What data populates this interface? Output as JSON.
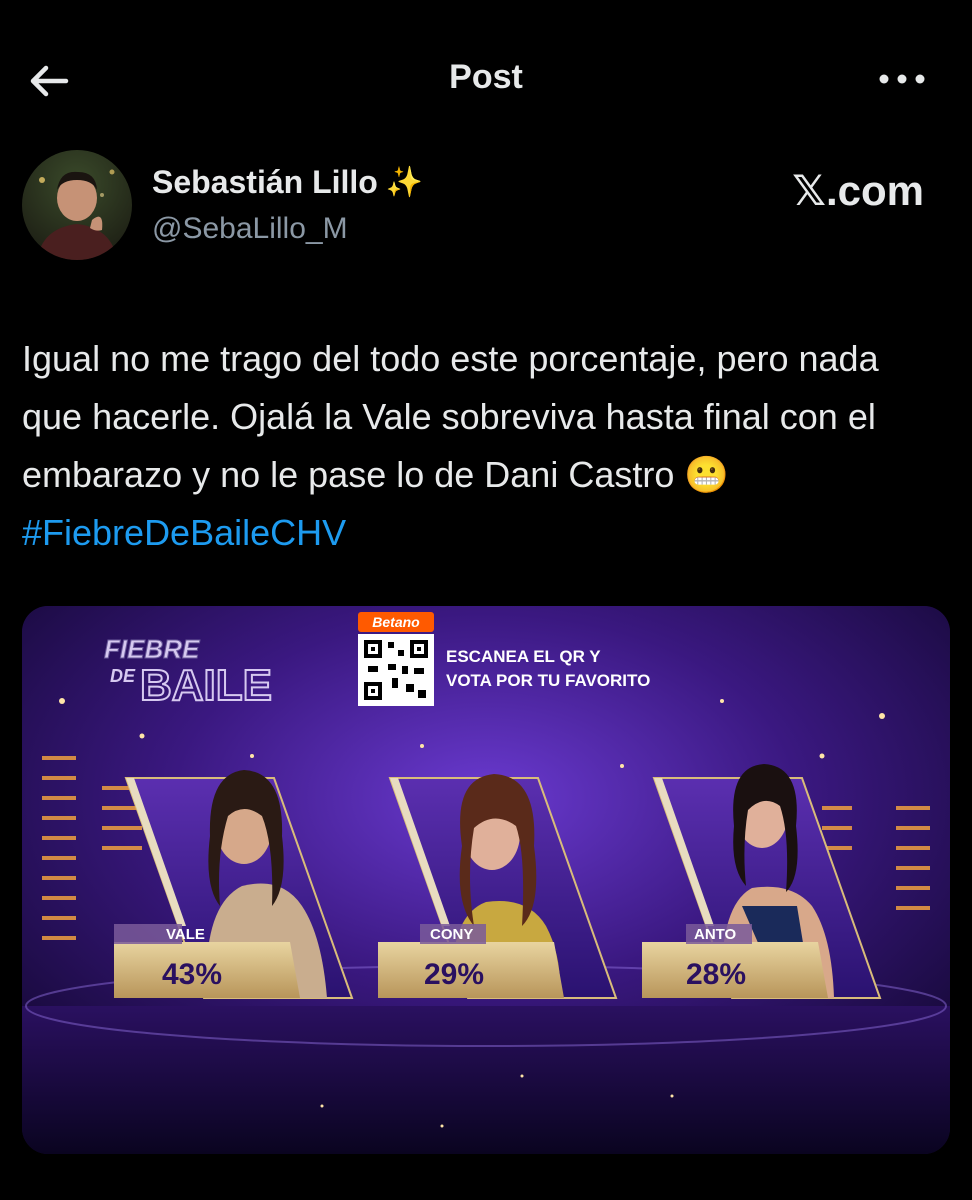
{
  "header": {
    "title": "Post",
    "back_icon": "arrow-left-icon",
    "more_icon": "more-horizontal-icon"
  },
  "author": {
    "display_name": "Sebastián Lillo",
    "emoji": "✨",
    "handle": "@SebaLillo_M",
    "brand": "𝕏.com"
  },
  "tweet": {
    "text": "Igual no me trago del todo este porcentaje, pero nada que hacerle. Ojalá la Vale sobreviva hasta final con el embarazo y no le pase lo de Dani Castro",
    "emoji": "😬",
    "hashtag": "#FiebreDeBaileCHV"
  },
  "media": {
    "show_logo_top": "FIEBRE",
    "show_logo_mid": "DE",
    "show_logo_bottom": "BAILE",
    "sponsor": "Betano",
    "scan_line1": "ESCANEA EL QR Y",
    "scan_line2": "VOTA POR TU FAVORITO",
    "contestants": [
      {
        "name": "VALE",
        "percent": "43%"
      },
      {
        "name": "CONY",
        "percent": "29%"
      },
      {
        "name": "ANTO",
        "percent": "28%"
      }
    ]
  },
  "colors": {
    "background": "#000000",
    "text": "#e7e9ea",
    "secondary": "#8b98a5",
    "link": "#1d9bf0",
    "gold": "#d9bc7a",
    "purple": "#3b1a7a"
  }
}
